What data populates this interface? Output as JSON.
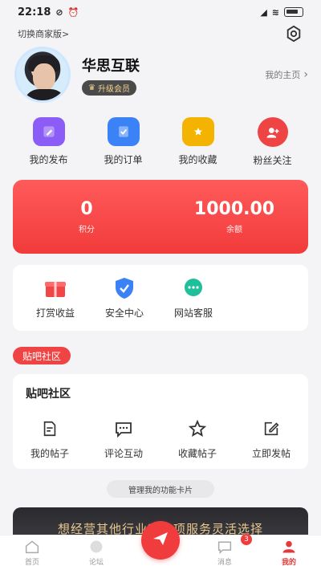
{
  "status_bar": {
    "time": "22:18",
    "battery_icon": "battery-icon"
  },
  "top": {
    "switch_label": "切换商家版>",
    "settings_icon": "settings-icon"
  },
  "profile": {
    "username": "华思互联",
    "vip_label": "升级会员",
    "homepage_label": "我的主页"
  },
  "quick_actions": [
    {
      "label": "我的发布",
      "icon": "edit-icon",
      "color": "#8b5cf6"
    },
    {
      "label": "我的订单",
      "icon": "order-icon",
      "color": "#3b82f6"
    },
    {
      "label": "我的收藏",
      "icon": "folder-star-icon",
      "color": "#f5b301"
    },
    {
      "label": "粉丝关注",
      "icon": "user-plus-icon",
      "color": "#ef4444"
    }
  ],
  "stats": {
    "points_value": "0",
    "points_label": "积分",
    "balance_value": "1000.00",
    "balance_label": "余额"
  },
  "services": [
    {
      "label": "打赏收益",
      "icon": "gift-icon",
      "color": "#f14646"
    },
    {
      "label": "安全中心",
      "icon": "shield-icon",
      "color": "#3b82f6"
    },
    {
      "label": "网站客服",
      "icon": "chat-icon",
      "color": "#1fbf9a"
    }
  ],
  "section_tag": "贴吧社区",
  "forum": {
    "title": "贴吧社区",
    "items": [
      {
        "label": "我的帖子",
        "icon": "post-icon"
      },
      {
        "label": "评论互动",
        "icon": "comment-icon"
      },
      {
        "label": "收藏帖子",
        "icon": "star-icon"
      },
      {
        "label": "立即发帖",
        "icon": "compose-icon"
      }
    ]
  },
  "manage_label": "管理我的功能卡片",
  "banner_text": "想经营其他行业？多项服务灵活选择",
  "tabbar": {
    "tabs": [
      {
        "label": "首页",
        "icon": "home-icon"
      },
      {
        "label": "论坛",
        "icon": "forum-icon"
      },
      {
        "label": "",
        "icon": "send-icon"
      },
      {
        "label": "消息",
        "icon": "message-icon",
        "badge": "3"
      },
      {
        "label": "我的",
        "icon": "profile-icon"
      }
    ]
  },
  "colors": {
    "accent": "#f03c3c",
    "card_red": "#f23b3b",
    "vip_gold": "#f3d28c"
  }
}
